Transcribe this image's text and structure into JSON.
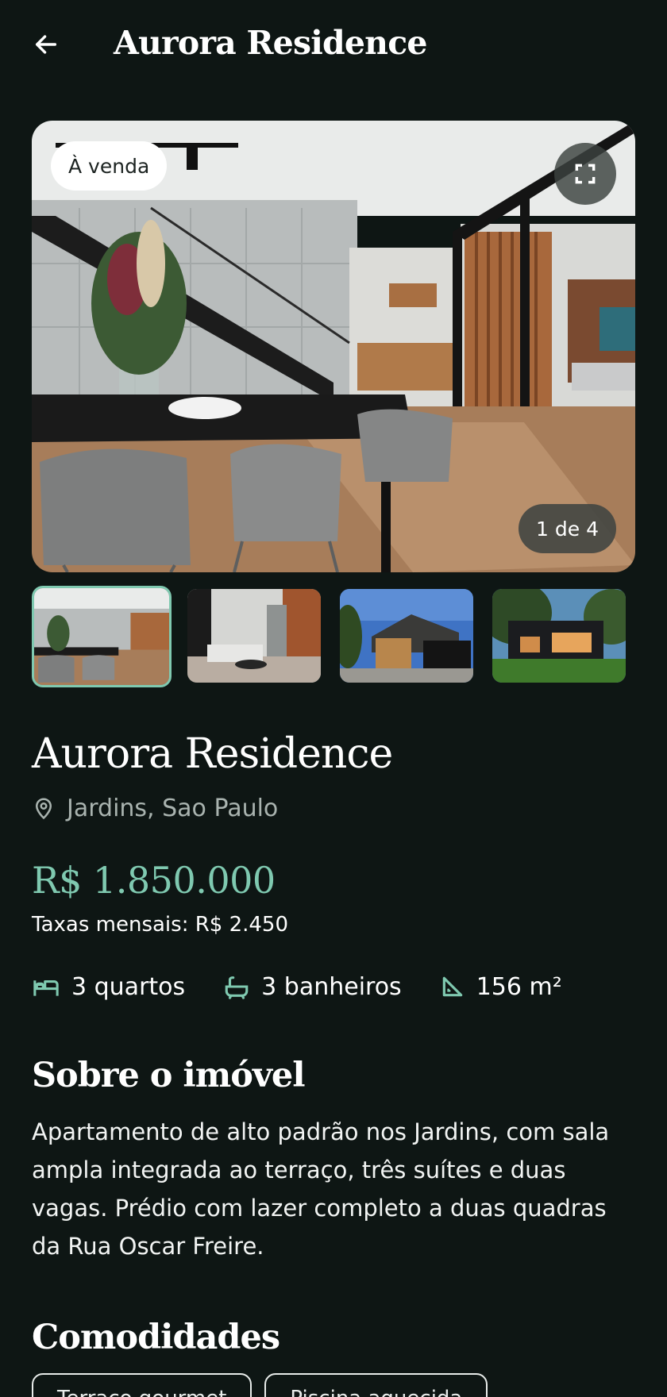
{
  "header": {
    "title": "Aurora Residence",
    "back_icon": "arrow-left-icon"
  },
  "gallery": {
    "badge": "À venda",
    "counter": "1 de 4",
    "expand_icon": "fullscreen-icon",
    "current_index": 1,
    "total": 4
  },
  "property": {
    "title": "Aurora Residence",
    "location": "Jardins, Sao Paulo",
    "location_icon": "map-pin-icon",
    "price": "R$ 1.850.000",
    "fees": "Taxas mensais: R$ 2.450",
    "features": [
      {
        "icon": "bed-icon",
        "label": "3 quartos"
      },
      {
        "icon": "bathtub-icon",
        "label": "3 banheiros"
      },
      {
        "icon": "area-ruler-icon",
        "label": "156 m²"
      }
    ]
  },
  "about": {
    "title": "Sobre o imóvel",
    "text": "Apartamento de alto padrão nos Jardins, com sala ampla integrada ao terraço, três suítes e duas vagas. Prédio com lazer completo a duas quadras da Rua Oscar Freire."
  },
  "amenities": {
    "title": "Comodidades",
    "chips": [
      "Terraço gourmet",
      "Piscina aquecida"
    ]
  },
  "colors": {
    "background": "#0e1614",
    "accent": "#7fc9b0",
    "text": "#ffffff",
    "muted": "#a9b3af"
  }
}
